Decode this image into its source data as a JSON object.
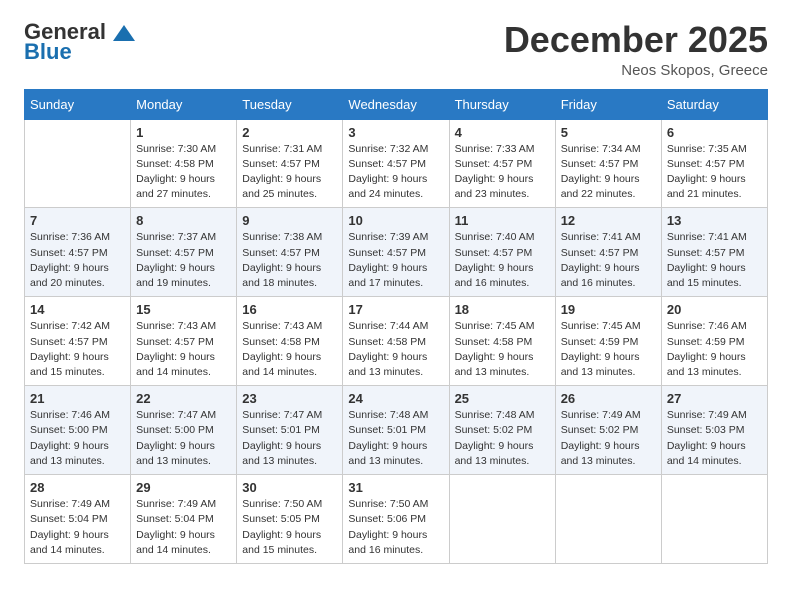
{
  "header": {
    "logo_line1": "General",
    "logo_line2": "Blue",
    "month_title": "December 2025",
    "location": "Neos Skopos, Greece"
  },
  "weekdays": [
    "Sunday",
    "Monday",
    "Tuesday",
    "Wednesday",
    "Thursday",
    "Friday",
    "Saturday"
  ],
  "weeks": [
    [
      {
        "day": "",
        "info": ""
      },
      {
        "day": "1",
        "info": "Sunrise: 7:30 AM\nSunset: 4:58 PM\nDaylight: 9 hours\nand 27 minutes."
      },
      {
        "day": "2",
        "info": "Sunrise: 7:31 AM\nSunset: 4:57 PM\nDaylight: 9 hours\nand 25 minutes."
      },
      {
        "day": "3",
        "info": "Sunrise: 7:32 AM\nSunset: 4:57 PM\nDaylight: 9 hours\nand 24 minutes."
      },
      {
        "day": "4",
        "info": "Sunrise: 7:33 AM\nSunset: 4:57 PM\nDaylight: 9 hours\nand 23 minutes."
      },
      {
        "day": "5",
        "info": "Sunrise: 7:34 AM\nSunset: 4:57 PM\nDaylight: 9 hours\nand 22 minutes."
      },
      {
        "day": "6",
        "info": "Sunrise: 7:35 AM\nSunset: 4:57 PM\nDaylight: 9 hours\nand 21 minutes."
      }
    ],
    [
      {
        "day": "7",
        "info": "Sunrise: 7:36 AM\nSunset: 4:57 PM\nDaylight: 9 hours\nand 20 minutes."
      },
      {
        "day": "8",
        "info": "Sunrise: 7:37 AM\nSunset: 4:57 PM\nDaylight: 9 hours\nand 19 minutes."
      },
      {
        "day": "9",
        "info": "Sunrise: 7:38 AM\nSunset: 4:57 PM\nDaylight: 9 hours\nand 18 minutes."
      },
      {
        "day": "10",
        "info": "Sunrise: 7:39 AM\nSunset: 4:57 PM\nDaylight: 9 hours\nand 17 minutes."
      },
      {
        "day": "11",
        "info": "Sunrise: 7:40 AM\nSunset: 4:57 PM\nDaylight: 9 hours\nand 16 minutes."
      },
      {
        "day": "12",
        "info": "Sunrise: 7:41 AM\nSunset: 4:57 PM\nDaylight: 9 hours\nand 16 minutes."
      },
      {
        "day": "13",
        "info": "Sunrise: 7:41 AM\nSunset: 4:57 PM\nDaylight: 9 hours\nand 15 minutes."
      }
    ],
    [
      {
        "day": "14",
        "info": "Sunrise: 7:42 AM\nSunset: 4:57 PM\nDaylight: 9 hours\nand 15 minutes."
      },
      {
        "day": "15",
        "info": "Sunrise: 7:43 AM\nSunset: 4:57 PM\nDaylight: 9 hours\nand 14 minutes."
      },
      {
        "day": "16",
        "info": "Sunrise: 7:43 AM\nSunset: 4:58 PM\nDaylight: 9 hours\nand 14 minutes."
      },
      {
        "day": "17",
        "info": "Sunrise: 7:44 AM\nSunset: 4:58 PM\nDaylight: 9 hours\nand 13 minutes."
      },
      {
        "day": "18",
        "info": "Sunrise: 7:45 AM\nSunset: 4:58 PM\nDaylight: 9 hours\nand 13 minutes."
      },
      {
        "day": "19",
        "info": "Sunrise: 7:45 AM\nSunset: 4:59 PM\nDaylight: 9 hours\nand 13 minutes."
      },
      {
        "day": "20",
        "info": "Sunrise: 7:46 AM\nSunset: 4:59 PM\nDaylight: 9 hours\nand 13 minutes."
      }
    ],
    [
      {
        "day": "21",
        "info": "Sunrise: 7:46 AM\nSunset: 5:00 PM\nDaylight: 9 hours\nand 13 minutes."
      },
      {
        "day": "22",
        "info": "Sunrise: 7:47 AM\nSunset: 5:00 PM\nDaylight: 9 hours\nand 13 minutes."
      },
      {
        "day": "23",
        "info": "Sunrise: 7:47 AM\nSunset: 5:01 PM\nDaylight: 9 hours\nand 13 minutes."
      },
      {
        "day": "24",
        "info": "Sunrise: 7:48 AM\nSunset: 5:01 PM\nDaylight: 9 hours\nand 13 minutes."
      },
      {
        "day": "25",
        "info": "Sunrise: 7:48 AM\nSunset: 5:02 PM\nDaylight: 9 hours\nand 13 minutes."
      },
      {
        "day": "26",
        "info": "Sunrise: 7:49 AM\nSunset: 5:02 PM\nDaylight: 9 hours\nand 13 minutes."
      },
      {
        "day": "27",
        "info": "Sunrise: 7:49 AM\nSunset: 5:03 PM\nDaylight: 9 hours\nand 14 minutes."
      }
    ],
    [
      {
        "day": "28",
        "info": "Sunrise: 7:49 AM\nSunset: 5:04 PM\nDaylight: 9 hours\nand 14 minutes."
      },
      {
        "day": "29",
        "info": "Sunrise: 7:49 AM\nSunset: 5:04 PM\nDaylight: 9 hours\nand 14 minutes."
      },
      {
        "day": "30",
        "info": "Sunrise: 7:50 AM\nSunset: 5:05 PM\nDaylight: 9 hours\nand 15 minutes."
      },
      {
        "day": "31",
        "info": "Sunrise: 7:50 AM\nSunset: 5:06 PM\nDaylight: 9 hours\nand 16 minutes."
      },
      {
        "day": "",
        "info": ""
      },
      {
        "day": "",
        "info": ""
      },
      {
        "day": "",
        "info": ""
      }
    ]
  ]
}
